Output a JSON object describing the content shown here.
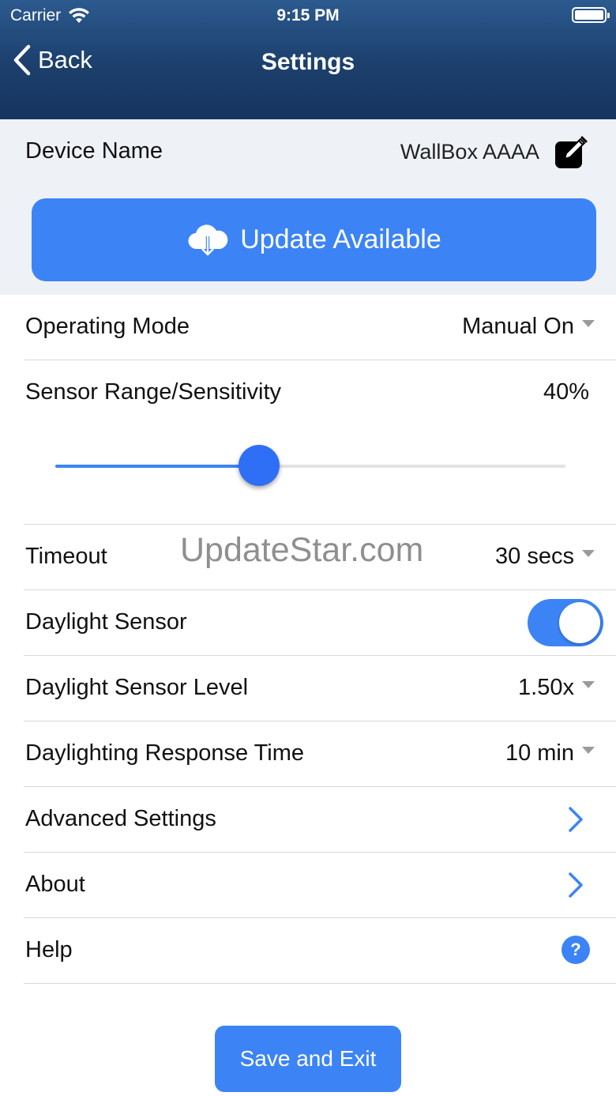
{
  "status_bar": {
    "carrier": "Carrier",
    "time": "9:15 PM"
  },
  "nav": {
    "back_label": "Back",
    "title": "Settings"
  },
  "device": {
    "label": "Device Name",
    "value": "WallBox AAAA"
  },
  "update_button": {
    "label": "Update Available"
  },
  "settings": {
    "operating_mode": {
      "label": "Operating Mode",
      "value": "Manual On"
    },
    "sensor_range": {
      "label": "Sensor Range/Sensitivity",
      "value": "40%",
      "level_fraction": 0.4
    },
    "timeout": {
      "label": "Timeout",
      "value": "30 secs"
    },
    "daylight_sensor": {
      "label": "Daylight Sensor",
      "enabled": true
    },
    "daylight_level": {
      "label": "Daylight Sensor Level",
      "value": "1.50x"
    },
    "daylight_response": {
      "label": "Daylighting Response Time",
      "value": "10 min"
    },
    "advanced": {
      "label": "Advanced Settings"
    },
    "about": {
      "label": "About"
    },
    "help": {
      "label": "Help",
      "icon_text": "?"
    }
  },
  "watermark": "UpdateStar.com",
  "save_button": {
    "label": "Save and Exit"
  },
  "colors": {
    "accent": "#3c84f6",
    "header": "#1c3f6c"
  }
}
